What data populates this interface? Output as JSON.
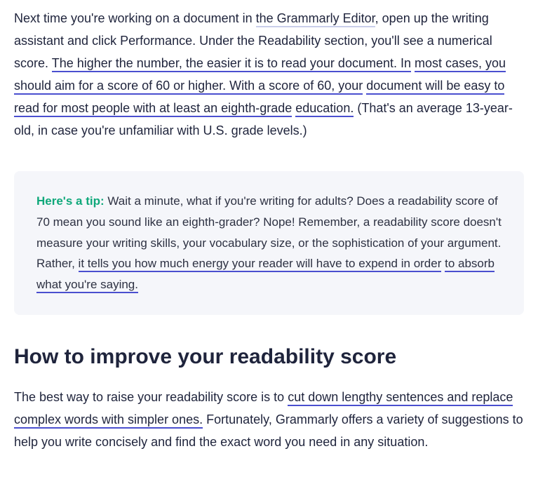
{
  "para1": {
    "t1": "Next time you're working on a document in ",
    "link": "the Grammarly Editor",
    "t2": ", open up the writing assistant and click Performance. Under the Readability section, you'll see a numerical score. ",
    "u1": "The higher the number, the easier it is to read your document. In",
    "sp1": " ",
    "u2": "most cases, you should aim for a score of 60 or higher. With a score of 60, your",
    "sp2": " ",
    "u3": "document will be easy to read for most people with at least an eighth-grade",
    "sp3": " ",
    "u4": "education.",
    "t3": " (That's an average 13-year-old, in case you're unfamiliar with U.S. grade levels.)"
  },
  "tip": {
    "label": "Here's a tip:",
    "t1": " Wait a minute, what if you're writing for adults? Does a readability score of 70 mean you sound like an eighth-grader? Nope! Remember, a readability score doesn't measure your writing skills, your vocabulary size, or the sophistication of your argument. Rather, ",
    "u1": "it tells you how much energy your reader will have to expend in order",
    "sp1": " ",
    "u2": "to absorb what you're saying."
  },
  "heading": "How to improve your readability score",
  "para2": {
    "t1": "The best way to raise your readability score is to ",
    "u1": "cut down lengthy sentences and ",
    "sp1": " ",
    "u2": "replace complex words with simpler ones.",
    "t2": " Fortunately, Grammarly offers a variety of suggestions to help you write concisely and find the exact word you need in any situation."
  }
}
